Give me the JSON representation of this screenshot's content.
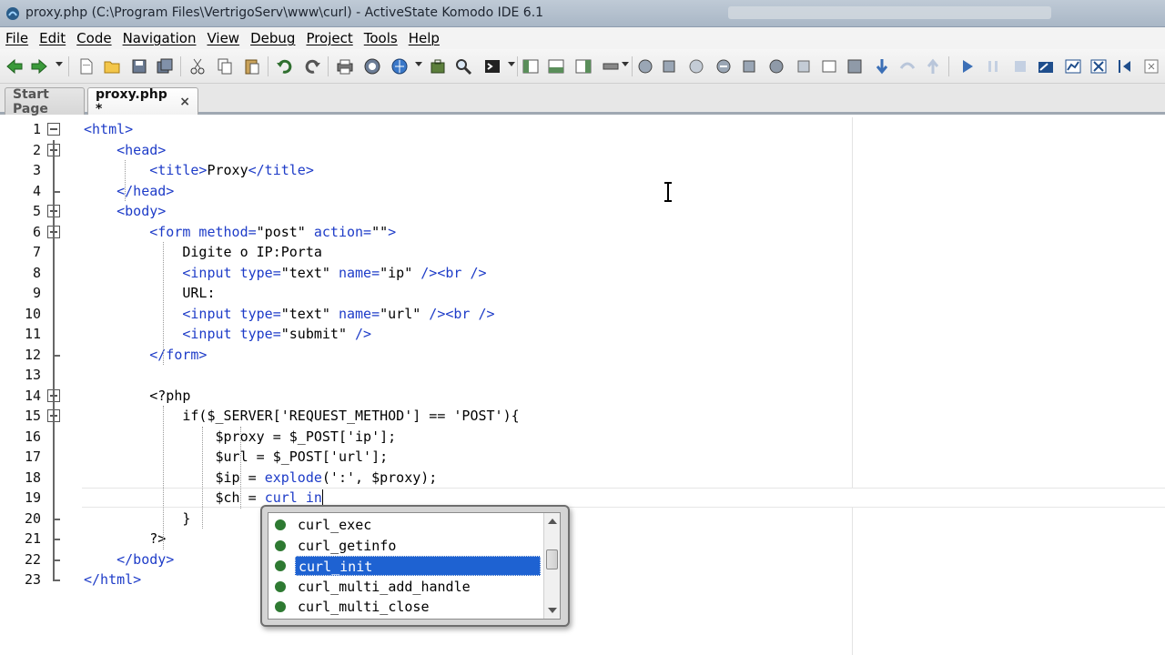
{
  "window": {
    "title": "proxy.php (C:\\Program Files\\VertrigoServ\\www\\curl) - ActiveState Komodo IDE 6.1"
  },
  "menu": [
    "File",
    "Edit",
    "Code",
    "Navigation",
    "View",
    "Debug",
    "Project",
    "Tools",
    "Help"
  ],
  "tabs": {
    "start_page": "Start Page",
    "active": "proxy.php *",
    "close_glyph": "×"
  },
  "editor": {
    "line_numbers": [
      "1",
      "2",
      "3",
      "4",
      "5",
      "6",
      "7",
      "8",
      "9",
      "10",
      "11",
      "12",
      "13",
      "14",
      "15",
      "16",
      "17",
      "18",
      "19",
      "20",
      "21",
      "22",
      "23"
    ],
    "lines": [
      "<html>",
      "    <head>",
      "        <title>Proxy</title>",
      "    </head>",
      "    <body>",
      "        <form method=\"post\" action=\"\">",
      "            Digite o IP:Porta",
      "            <input type=\"text\" name=\"ip\" /><br />",
      "            URL:",
      "            <input type=\"text\" name=\"url\" /><br />",
      "            <input type=\"submit\" />",
      "        </form>",
      "",
      "        <?php",
      "            if($_SERVER['REQUEST_METHOD'] == 'POST'){",
      "                $proxy = $_POST['ip'];",
      "                $url = $_POST['url'];",
      "                $ip = explode(':', $proxy);",
      "                $ch = curl_in",
      "            }",
      "        ?>",
      "    </body>",
      "</html>"
    ],
    "current_line": 19
  },
  "autocomplete": {
    "items": [
      "curl_exec",
      "curl_getinfo",
      "curl_init",
      "curl_multi_add_handle",
      "curl_multi_close"
    ],
    "selected_index": 2,
    "item_icon": "function-dot-icon"
  },
  "colors": {
    "tag": "#1e3cc8",
    "selection": "#1e62d2",
    "function_dot": "#2e7a32"
  }
}
